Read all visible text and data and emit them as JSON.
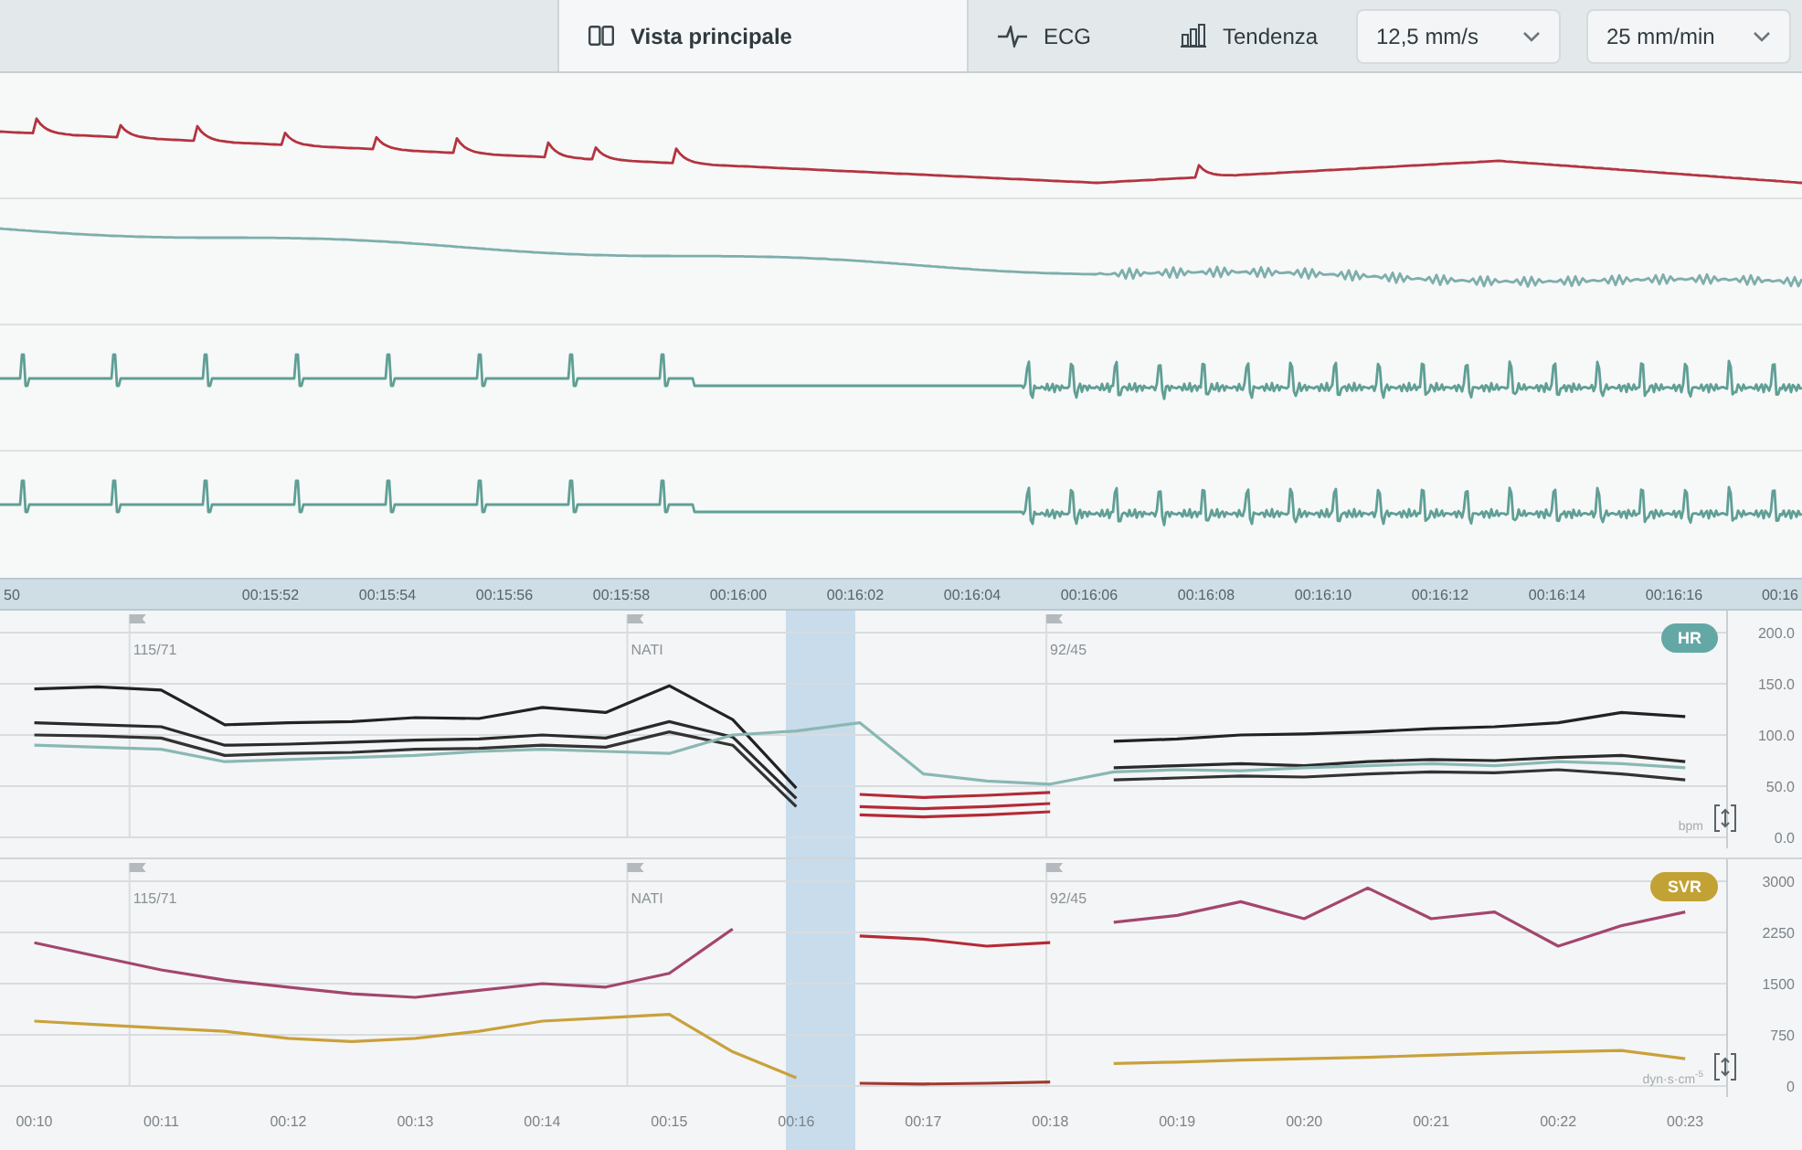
{
  "toolbar": {
    "tabs": [
      {
        "label": "Vista principale",
        "kind": "overview",
        "selected": true
      },
      {
        "label": "ECG",
        "kind": "waveform",
        "selected": false
      },
      {
        "label": "Tendenza",
        "kind": "trend",
        "selected": false
      }
    ],
    "selects": [
      {
        "value": "12,5 mm/s"
      },
      {
        "value": "25 mm/min"
      }
    ]
  },
  "waveforms": {
    "strips": [
      {
        "kind": "pressure",
        "color": "#b3343f"
      },
      {
        "kind": "respiration",
        "color": "#7eaeab"
      },
      {
        "kind": "ecg",
        "color": "#5f9f95"
      },
      {
        "kind": "ecg",
        "color": "#5f9f95"
      }
    ],
    "time_labels": [
      "50",
      "00:15:52",
      "00:15:54",
      "00:15:56",
      "00:15:58",
      "00:16:00",
      "00:16:02",
      "00:16:04",
      "00:16:06",
      "00:16:08",
      "00:16:10",
      "00:16:12",
      "00:16:14",
      "00:16:16",
      "00:16"
    ]
  },
  "trend_panels": [
    {
      "color": "#64a8a6",
      "unit": "bpm",
      "chart_data": {
        "type": "line",
        "title": "HR",
        "grid": true,
        "x": [
          10,
          10.5,
          11,
          11.5,
          12,
          12.5,
          13,
          13.5,
          14,
          14.5,
          15,
          15.5,
          16,
          16.5,
          17,
          17.5,
          18,
          18.5,
          19,
          19.5,
          20,
          20.5,
          21,
          21.5,
          22,
          22.5,
          23
        ],
        "xlim": [
          9.73,
          23.33
        ],
        "ylim": [
          0,
          200
        ],
        "yticks": [
          {
            "value": 0,
            "label": "0.0"
          },
          {
            "value": 50,
            "label": "50.0"
          },
          {
            "value": 100,
            "label": "100.0"
          },
          {
            "value": 150,
            "label": "150.0"
          },
          {
            "value": 200,
            "label": "200.0"
          }
        ],
        "series": [
          {
            "color": "#222222",
            "values": [
              145,
              147,
              144,
              110,
              112,
              113,
              117,
              116,
              127,
              122,
              148,
              115,
              48,
              null,
              null,
              null,
              null,
              94,
              96,
              100,
              101,
              103,
              106,
              108,
              112,
              122,
              118
            ]
          },
          {
            "color": "#2a2a2a",
            "values": [
              112,
              110,
              108,
              90,
              91,
              93,
              95,
              96,
              100,
              97,
              113,
              98,
              38,
              null,
              null,
              null,
              null,
              68,
              70,
              72,
              70,
              74,
              76,
              75,
              78,
              80,
              74
            ]
          },
          {
            "color": "#333333",
            "values": [
              100,
              99,
              97,
              80,
              82,
              83,
              86,
              87,
              90,
              88,
              103,
              90,
              30,
              null,
              null,
              null,
              null,
              56,
              58,
              60,
              59,
              62,
              64,
              63,
              66,
              62,
              56
            ]
          },
          {
            "color": "#8ab8b4",
            "values": [
              90,
              88,
              86,
              74,
              76,
              78,
              80,
              84,
              86,
              84,
              82,
              100,
              104,
              112,
              62,
              55,
              52,
              64,
              66,
              65,
              68,
              70,
              72,
              70,
              74,
              72,
              68
            ]
          },
          {
            "color": "#b52a36",
            "values": [
              null,
              null,
              null,
              null,
              null,
              null,
              null,
              null,
              null,
              null,
              null,
              null,
              null,
              42,
              39,
              41,
              44,
              null,
              null,
              null,
              null,
              null,
              null,
              null,
              null,
              null,
              null
            ]
          },
          {
            "color": "#b52a36",
            "values": [
              null,
              null,
              null,
              null,
              null,
              null,
              null,
              null,
              null,
              null,
              null,
              null,
              null,
              30,
              28,
              30,
              33,
              null,
              null,
              null,
              null,
              null,
              null,
              null,
              null,
              null,
              null
            ]
          },
          {
            "color": "#b52a36",
            "values": [
              null,
              null,
              null,
              null,
              null,
              null,
              null,
              null,
              null,
              null,
              null,
              null,
              null,
              22,
              20,
              22,
              25,
              null,
              null,
              null,
              null,
              null,
              null,
              null,
              null,
              null,
              null
            ]
          }
        ],
        "annotations": [
          "115/71",
          "NATI",
          "92/45"
        ]
      }
    },
    {
      "color": "#c2a234",
      "unit": "dyn·s·cm$^{-5}$",
      "chart_data": {
        "type": "line",
        "title": "SVR",
        "grid": true,
        "x": [
          10,
          10.5,
          11,
          11.5,
          12,
          12.5,
          13,
          13.5,
          14,
          14.5,
          15,
          15.5,
          16,
          16.5,
          17,
          17.5,
          18,
          18.5,
          19,
          19.5,
          20,
          20.5,
          21,
          21.5,
          22,
          22.5,
          23
        ],
        "xlim": [
          9.73,
          23.33
        ],
        "ylim": [
          0,
          3000
        ],
        "xticks": [
          {
            "value": 10,
            "label": "00:10"
          },
          {
            "value": 11,
            "label": "00:11"
          },
          {
            "value": 12,
            "label": "00:12"
          },
          {
            "value": 13,
            "label": "00:13"
          },
          {
            "value": 14,
            "label": "00:14"
          },
          {
            "value": 15,
            "label": "00:15"
          },
          {
            "value": 16,
            "label": "00:16"
          },
          {
            "value": 17,
            "label": "00:17"
          },
          {
            "value": 18,
            "label": "00:18"
          },
          {
            "value": 19,
            "label": "00:19"
          },
          {
            "value": 20,
            "label": "00:20"
          },
          {
            "value": 21,
            "label": "00:21"
          },
          {
            "value": 22,
            "label": "00:22"
          },
          {
            "value": 23,
            "label": "00:23"
          }
        ],
        "yticks": [
          0,
          750,
          1500,
          2250,
          3000
        ],
        "series": [
          {
            "color": "#a3466e",
            "values": [
              2100,
              1900,
              1700,
              1550,
              1450,
              1350,
              1300,
              1400,
              1500,
              1450,
              1650,
              2300,
              null,
              null,
              null,
              null,
              null,
              2400,
              2500,
              2700,
              2450,
              2900,
              2450,
              2550,
              2050,
              2350,
              2550
            ]
          },
          {
            "color": "#b52a36",
            "values": [
              null,
              null,
              null,
              null,
              null,
              null,
              null,
              null,
              null,
              null,
              null,
              null,
              null,
              2200,
              2150,
              2050,
              2100,
              null,
              null,
              null,
              null,
              null,
              null,
              null,
              null,
              null,
              null
            ]
          },
          {
            "color": "#c9a13c",
            "values": [
              950,
              900,
              850,
              800,
              700,
              650,
              700,
              800,
              950,
              1000,
              1050,
              500,
              120,
              null,
              null,
              null,
              null,
              330,
              350,
              380,
              400,
              420,
              450,
              480,
              500,
              520,
              400
            ]
          },
          {
            "color": "#a03a30",
            "values": [
              null,
              null,
              null,
              null,
              null,
              null,
              null,
              null,
              null,
              null,
              null,
              null,
              null,
              40,
              30,
              40,
              60,
              null,
              null,
              null,
              null,
              null,
              null,
              null,
              null,
              null,
              null
            ]
          }
        ],
        "annotations": [
          "115/71",
          "NATI",
          "92/45"
        ]
      }
    }
  ]
}
